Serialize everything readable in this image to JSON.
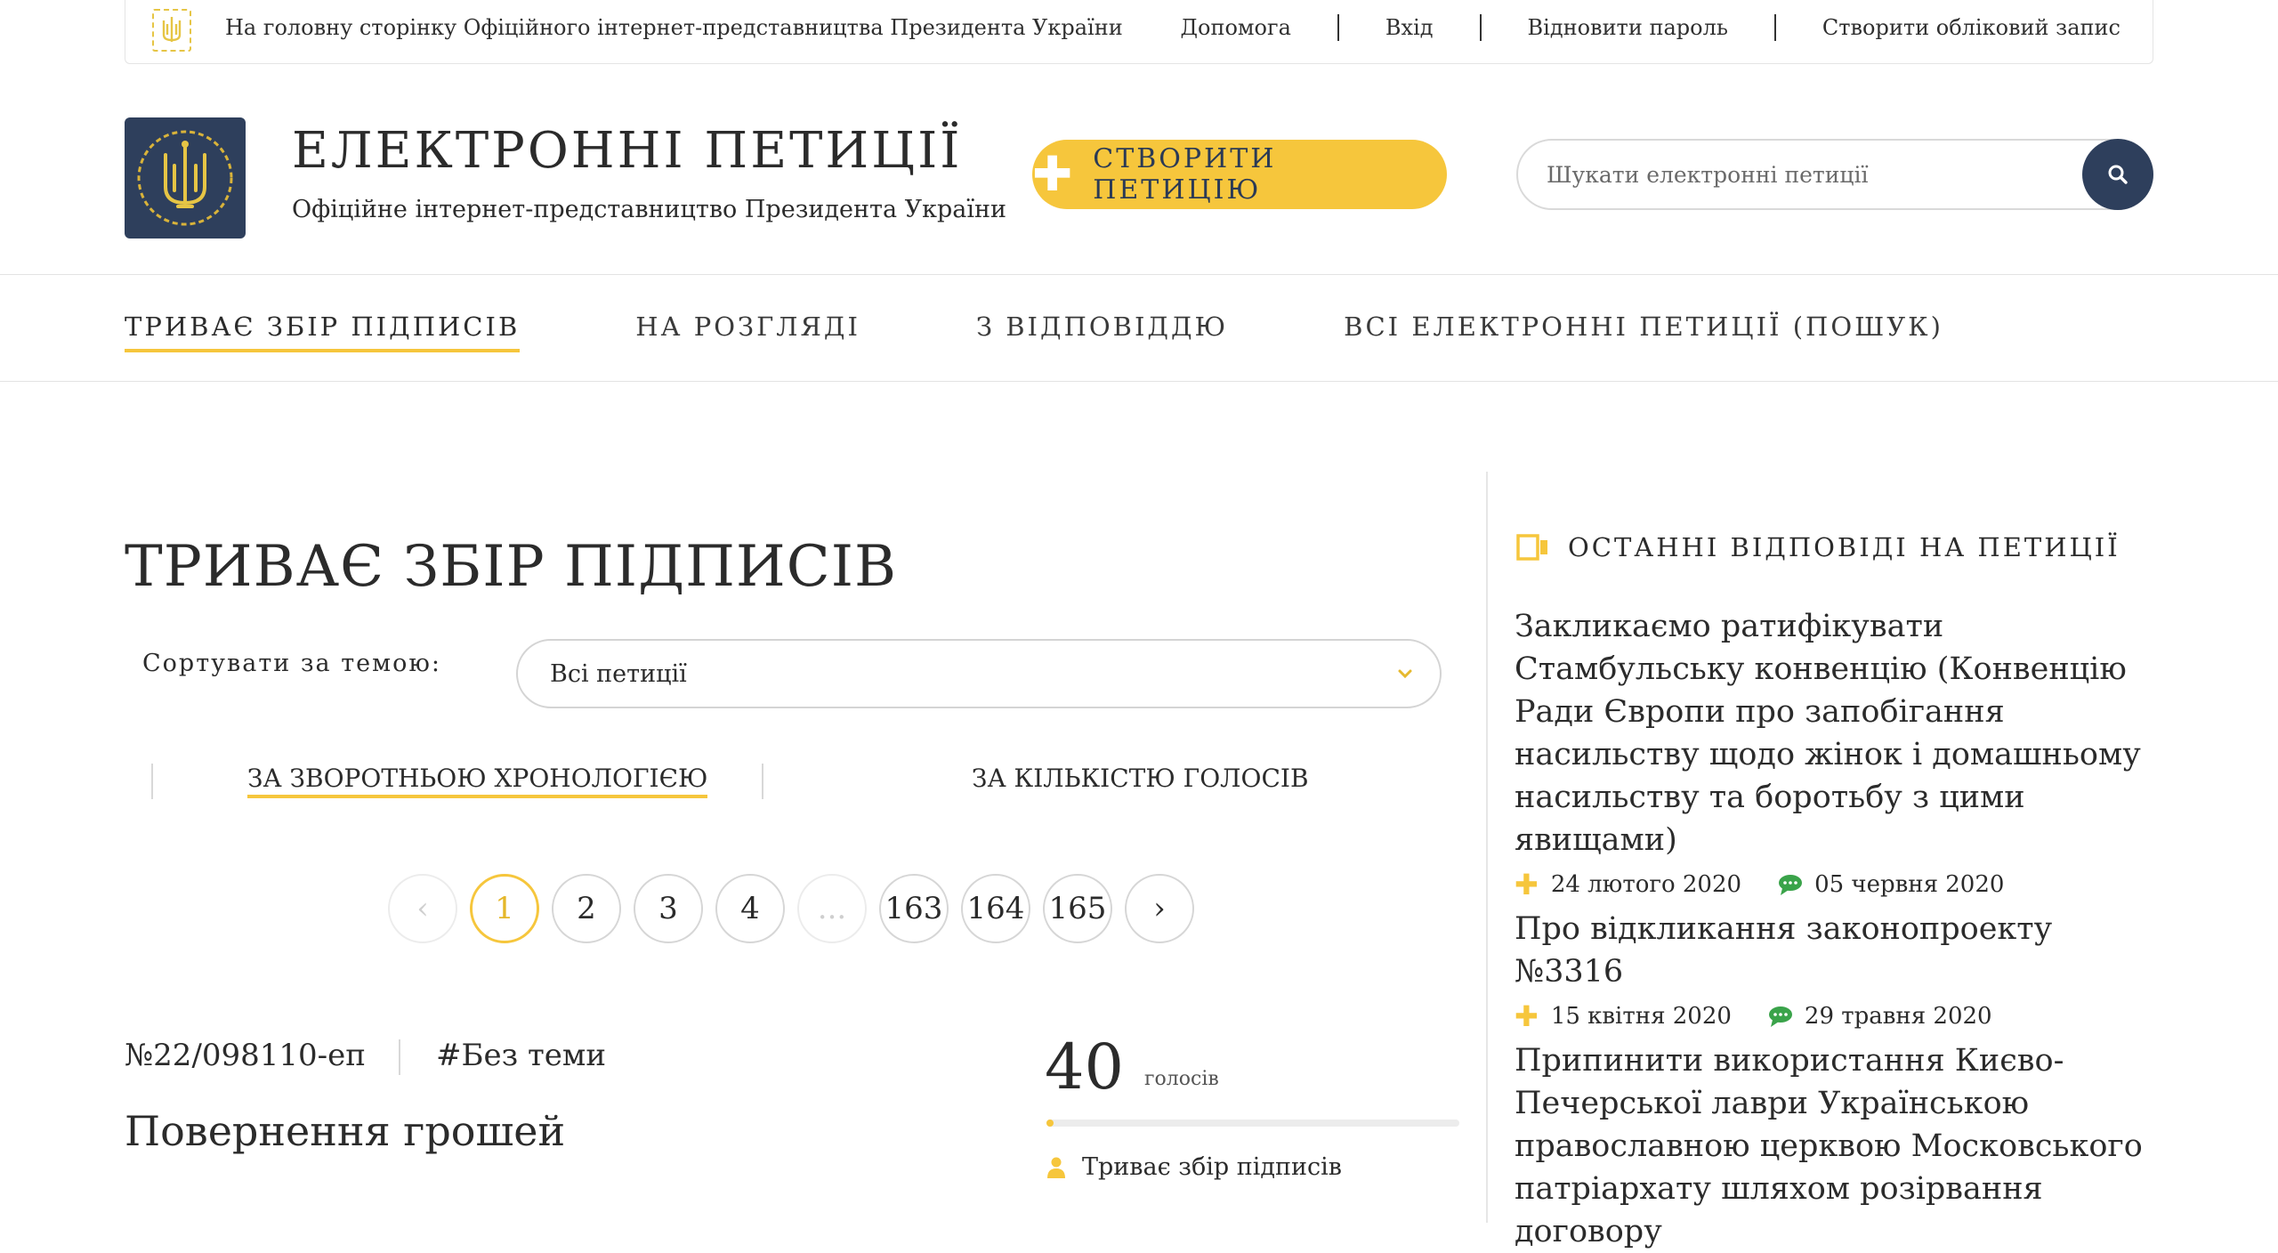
{
  "topbar": {
    "home_link": "На головну сторінку Офіційного інтернет-представництва Президента України",
    "links": [
      "Допомога",
      "Вхід",
      "Відновити пароль",
      "Створити обліковий запис"
    ]
  },
  "header": {
    "title": "ЕЛЕКТРОННІ ПЕТИЦІЇ",
    "subtitle": "Офіційне інтернет-представництво Президента України",
    "create_button": "СТВОРИТИ ПЕТИЦІЮ",
    "search_placeholder": "Шукати електронні петиції"
  },
  "nav": {
    "tabs": [
      {
        "label": "ТРИВАЄ ЗБІР ПІДПИСІВ",
        "active": true
      },
      {
        "label": "НА РОЗГЛЯДІ",
        "active": false
      },
      {
        "label": "З ВІДПОВІДДЮ",
        "active": false
      },
      {
        "label": "ВСІ ЕЛЕКТРОННІ ПЕТИЦІЇ (ПОШУК)",
        "active": false
      }
    ]
  },
  "main": {
    "title": "ТРИВАЄ ЗБІР ПІДПИСІВ",
    "sort_label": "Сортувати за темою:",
    "sort_value": "Всі петиції",
    "order_options": [
      "ЗА ЗВОРОТНЬОЮ ХРОНОЛОГІЄЮ",
      "ЗА КІЛЬКІСТЮ ГОЛОСІВ"
    ],
    "pagination": [
      "‹",
      "1",
      "2",
      "3",
      "4",
      "...",
      "163",
      "164",
      "165",
      "›"
    ],
    "current_page": "1",
    "petition": {
      "number": "№22/098110-еп",
      "tag": "#Без теми",
      "title": "Повернення грошей",
      "votes": "40",
      "votes_label": "голосів",
      "status": "Триває збір підписів"
    }
  },
  "sidebar": {
    "heading": "ОСТАННІ ВІДПОВІДІ НА ПЕТИЦІЇ",
    "items": [
      {
        "title": "Закликаємо ратифікувати Стамбульську конвенцію (Конвенцію Ради Європи про запобігання насильству щодо жінок і домашньому насильству та боротьбу з цими явищами)",
        "created": "24 лютого 2020",
        "answered": "05 червня 2020"
      },
      {
        "title": "Про відкликання законопроекту №3316",
        "created": "15 квітня 2020",
        "answered": "29 травня 2020"
      },
      {
        "title": "Припинити використання Києво-Печерської лаври Українською православною церквою Московського патріархату шляхом розірвання договору",
        "created": "",
        "answered": ""
      }
    ]
  },
  "colors": {
    "accent_yellow": "#f6c63c",
    "navy": "#2e3f5c",
    "chat_green": "#3aa34a"
  }
}
